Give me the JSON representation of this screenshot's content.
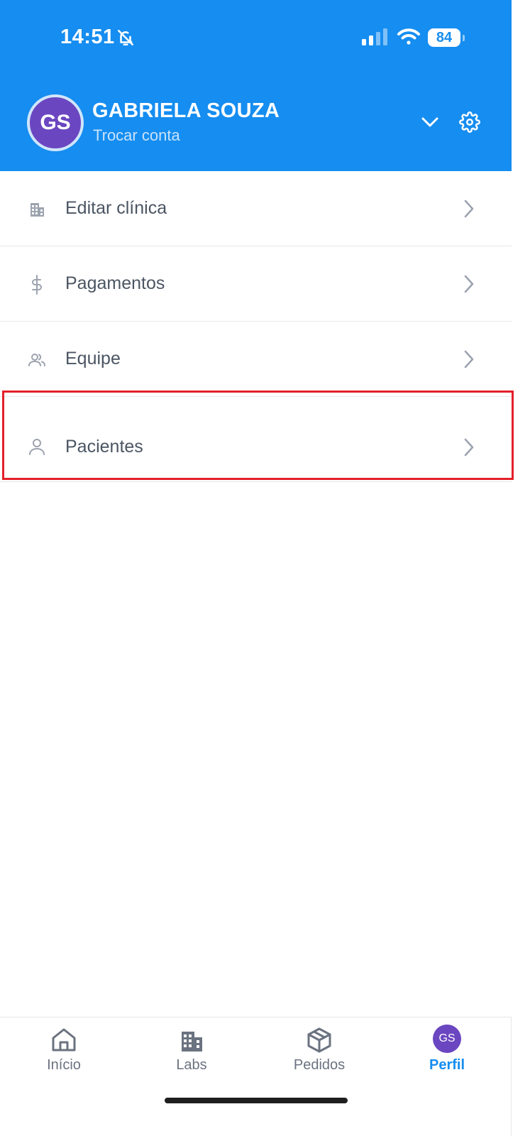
{
  "status_bar": {
    "time": "14:51",
    "battery": "84"
  },
  "header": {
    "avatar_initials": "GS",
    "account_name": "GABRIELA SOUZA",
    "switch_account": "Trocar conta"
  },
  "menu": {
    "items": [
      {
        "label": "Editar clínica",
        "icon": "building-icon"
      },
      {
        "label": "Pagamentos",
        "icon": "dollar-icon"
      },
      {
        "label": "Equipe",
        "icon": "team-icon"
      },
      {
        "label": "Pacientes",
        "icon": "user-icon",
        "highlighted": true
      }
    ]
  },
  "bottom_nav": {
    "items": [
      {
        "label": "Início",
        "icon": "home-icon",
        "active": false
      },
      {
        "label": "Labs",
        "icon": "buildings-icon",
        "active": false
      },
      {
        "label": "Pedidos",
        "icon": "box-icon",
        "active": false
      },
      {
        "label": "Perfil",
        "icon": "avatar",
        "avatar_initials": "GS",
        "active": true
      }
    ]
  },
  "colors": {
    "header_bg": "#168df0",
    "accent": "#168df0",
    "avatar_bg": "#6b46c1",
    "highlight": "#e3202a"
  }
}
